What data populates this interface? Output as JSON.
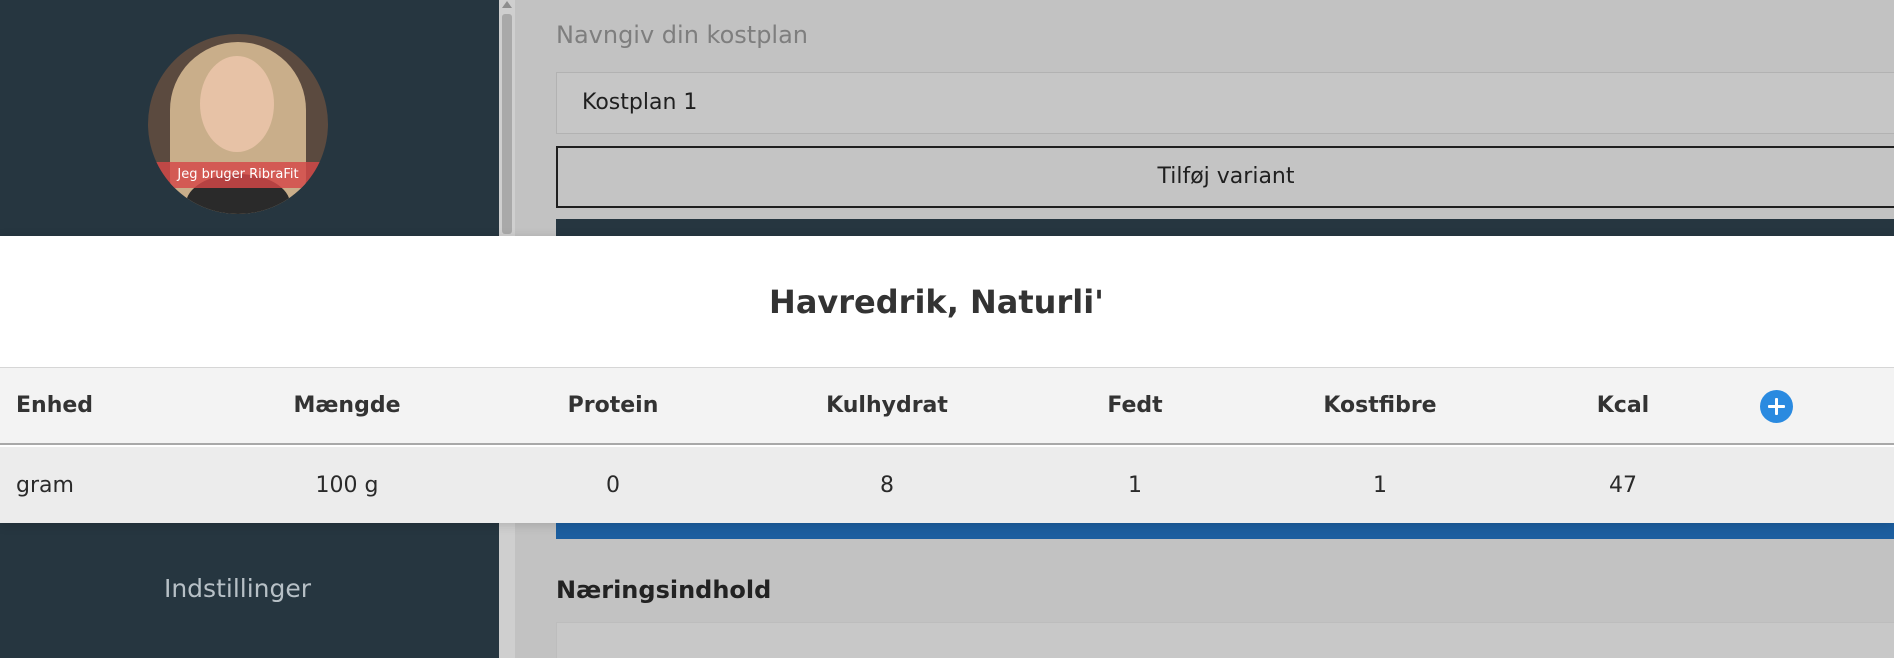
{
  "sidebar": {
    "avatar_badge": "Jeg bruger RibraFit",
    "settings_label": "Indstillinger"
  },
  "form": {
    "plan_label": "Navngiv din kostplan",
    "plan_name_value": "Kostplan 1",
    "add_variant_label": "Tilføj variant",
    "nutrition_heading": "Næringsindhold"
  },
  "modal": {
    "title": "Havredrik, Naturli'",
    "columns": [
      "Enhed",
      "Mængde",
      "Protein",
      "Kulhydrat",
      "Fedt",
      "Kostfibre",
      "Kcal"
    ],
    "row": {
      "enhed": "gram",
      "maengde": "100 g",
      "protein": "0",
      "kulhydrat": "8",
      "fedt": "1",
      "kostfibre": "1",
      "kcal": "47"
    },
    "add_icon": "plus-circle-icon"
  },
  "colors": {
    "sidebar_bg": "#263640",
    "accent_blue": "#2a8ae0",
    "primary_bar": "#1c5e9f"
  }
}
